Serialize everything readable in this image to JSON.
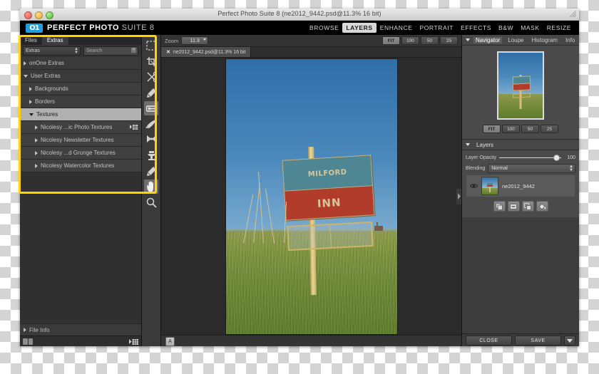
{
  "window": {
    "title": "Perfect Photo Suite 8 (ne2012_9442.psd@11.3% 16 bit)",
    "traffic_lights": [
      "close",
      "minimize",
      "zoom"
    ]
  },
  "brand": {
    "logo": "on1-logo",
    "name_bold": "PERFECT PHOTO",
    "name_light": "SUITE 8"
  },
  "module_menu": {
    "items": [
      {
        "label": "BROWSE",
        "active": false
      },
      {
        "label": "LAYERS",
        "active": true
      },
      {
        "label": "ENHANCE",
        "active": false
      },
      {
        "label": "PORTRAIT",
        "active": false
      },
      {
        "label": "EFFECTS",
        "active": false
      },
      {
        "label": "B&W",
        "active": false
      },
      {
        "label": "MASK",
        "active": false
      },
      {
        "label": "RESIZE",
        "active": false
      }
    ]
  },
  "left_panel": {
    "tabs": [
      {
        "label": "Files",
        "active": false
      },
      {
        "label": "Extras",
        "active": true
      }
    ],
    "category_select": {
      "value": "Extras",
      "icon": "updown-arrows-icon"
    },
    "search": {
      "placeholder": "Search",
      "value": "",
      "clear_icon": "clear-x-icon"
    },
    "tree": [
      {
        "label": "onOne Extras",
        "level": 0,
        "state": "collapsed",
        "selected": false,
        "extra_icon": null
      },
      {
        "label": "User Extras",
        "level": 0,
        "state": "expanded",
        "selected": false,
        "extra_icon": null
      },
      {
        "label": "Backgrounds",
        "level": 1,
        "state": "collapsed",
        "selected": false,
        "extra_icon": null
      },
      {
        "label": "Borders",
        "level": 1,
        "state": "collapsed",
        "selected": false,
        "extra_icon": null
      },
      {
        "label": "Textures",
        "level": 1,
        "state": "expanded",
        "selected": true,
        "extra_icon": null
      },
      {
        "label": "Nicolesy ...ic Photo Textures",
        "level": 2,
        "state": "collapsed",
        "selected": false,
        "extra_icon": "grid-list-icon"
      },
      {
        "label": "Nicolesy Newsletter Textures",
        "level": 2,
        "state": "collapsed",
        "selected": false,
        "extra_icon": null
      },
      {
        "label": "Nicolesy ...d Grunge Textures",
        "level": 2,
        "state": "collapsed",
        "selected": false,
        "extra_icon": null
      },
      {
        "label": "Nicolesy Watercolor Textures",
        "level": 2,
        "state": "collapsed",
        "selected": false,
        "extra_icon": null
      }
    ],
    "file_info": {
      "label": "File Info",
      "state": "collapsed"
    },
    "footer": {
      "view_toggle_icon": "two-column-view-icon",
      "grid_icon": "grid-list-icon"
    }
  },
  "toolbar": {
    "tools": [
      {
        "name": "crop-marquee-tool",
        "active": false
      },
      {
        "name": "transform-crop-tool",
        "active": false
      },
      {
        "name": "trim-scissors-tool",
        "active": false
      },
      {
        "name": "retouch-brush-tool",
        "active": false
      },
      {
        "name": "perfect-eraser-tool",
        "active": true
      },
      {
        "name": "masking-brush-tool",
        "active": false
      },
      {
        "name": "chisel-refine-tool",
        "active": false
      },
      {
        "name": "clone-stamp-tool",
        "active": false
      },
      {
        "name": "red-eye-tool",
        "active": false
      },
      {
        "name": "pan-hand-tool",
        "active": true
      },
      {
        "name": "zoom-magnifier-tool",
        "active": false
      }
    ]
  },
  "zoom_bar": {
    "label": "Zoom",
    "value": "11.3",
    "buttons": [
      {
        "label": "FIT",
        "active": true
      },
      {
        "label": "100",
        "active": false
      },
      {
        "label": "50",
        "active": false
      },
      {
        "label": "25",
        "active": false
      }
    ]
  },
  "document_tab": {
    "close_icon": "close-x-icon",
    "title": "ne2012_9442.psd@11.3% 16 bit"
  },
  "photo": {
    "sign_line_1": "MILFORD",
    "sign_line_2": "INN",
    "description": "Weathered roadside motel sign in a tall grass field at golden hour"
  },
  "status_bar": {
    "badge": "A"
  },
  "right_panel": {
    "top_tabs": [
      {
        "label": "Navigator",
        "active": true
      },
      {
        "label": "Loupe",
        "active": false
      },
      {
        "label": "Histogram",
        "active": false
      },
      {
        "label": "Info",
        "active": false
      }
    ],
    "navigator_buttons": [
      {
        "label": "FIT",
        "active": true
      },
      {
        "label": "100",
        "active": false
      },
      {
        "label": "50",
        "active": false
      },
      {
        "label": "25",
        "active": false
      }
    ],
    "layers": {
      "title": "Layers",
      "opacity_label": "Layer Opacity",
      "opacity_value": "100",
      "blending_label": "Blending",
      "blending_value": "Normal",
      "rows": [
        {
          "name": "ne2012_9442",
          "visible": true,
          "eye_icon": "eye-icon"
        }
      ],
      "tool_icons": [
        {
          "name": "copy-layer-icon"
        },
        {
          "name": "delete-layer-icon"
        },
        {
          "name": "merge-layer-icon"
        },
        {
          "name": "fill-bucket-icon"
        }
      ]
    },
    "footer": {
      "close_label": "CLOSE",
      "save_label": "SAVE",
      "caret_icon": "caret-down-icon"
    }
  },
  "annotation": {
    "highlight_color": "#ffd400",
    "target": "extras-browser-panel"
  }
}
